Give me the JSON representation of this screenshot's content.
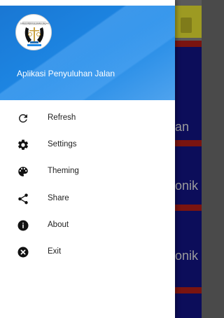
{
  "app": {
    "title": "Aplikasi Penyuluhan Jalan",
    "logo_text": "JURUS PENYULUHAN JALAN"
  },
  "menu": {
    "items": [
      {
        "label": "Refresh",
        "icon": "refresh-icon"
      },
      {
        "label": "Settings",
        "icon": "gear-icon"
      },
      {
        "label": "Theming",
        "icon": "palette-icon"
      },
      {
        "label": "Share",
        "icon": "share-icon"
      },
      {
        "label": "About",
        "icon": "info-icon"
      },
      {
        "label": "Exit",
        "icon": "close-circle-icon"
      }
    ]
  },
  "background": {
    "cards": [
      "an",
      "onik",
      "onik"
    ]
  },
  "colors": {
    "header_blue": "#1e88e5",
    "appbar_olive": "#9d9a22",
    "card_navy": "#0c0d5a",
    "card_red": "#7a1410"
  }
}
